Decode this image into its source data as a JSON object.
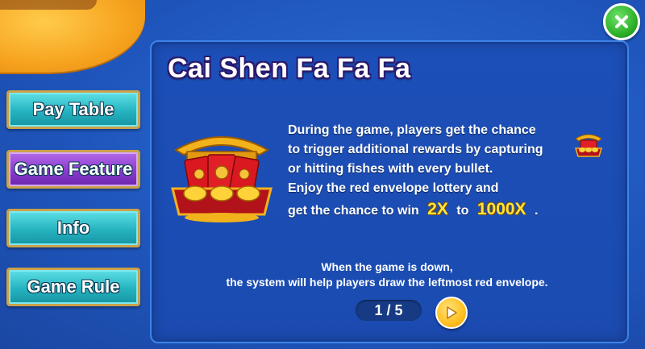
{
  "title": "Cai Shen Fa Fa Fa",
  "menu": [
    {
      "label": "Pay Table",
      "active": false
    },
    {
      "label": "Game Feature",
      "active": true
    },
    {
      "label": "Info",
      "active": false
    },
    {
      "label": "Game Rule",
      "active": false
    }
  ],
  "description": {
    "line1": "During the game, players get the chance",
    "line2": "to trigger additional rewards by capturing",
    "line3": "or hitting fishes with every bullet.",
    "line4": "Enjoy the red envelope lottery and",
    "line5_prefix": "get the chance to win",
    "multiplier_min": "2X",
    "line5_mid": "to",
    "multiplier_max": "1000X",
    "line5_suffix": "."
  },
  "note": {
    "line1": "When the game is down,",
    "line2": "the system will help players draw the leftmost red envelope."
  },
  "pager": {
    "text": "1 / 5"
  },
  "icons": {
    "close": "close-icon",
    "next": "play-arrow-icon",
    "feature": "red-envelope-lantern-icon"
  },
  "colors": {
    "highlight": "#ffe43a",
    "panel": "#1c4fb8",
    "teal_button": "#25b3c0",
    "active_button": "#8a3bcf"
  }
}
